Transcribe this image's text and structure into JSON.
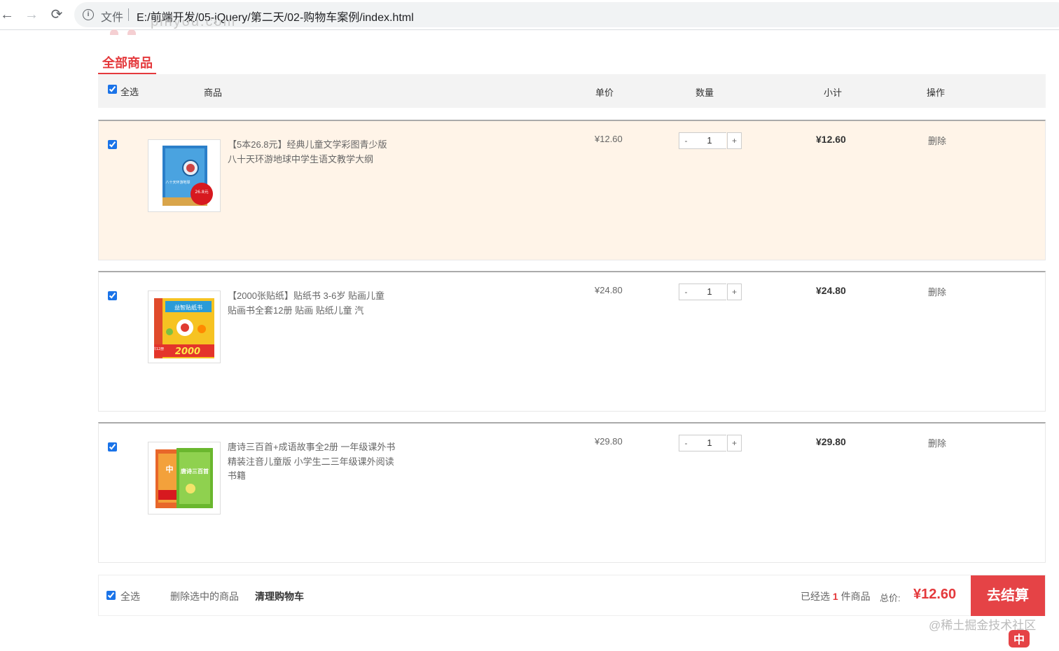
{
  "browser": {
    "back": "←",
    "forward": "→",
    "reload": "⟳",
    "info": "i",
    "file_label": "文件",
    "url": "E:/前端开发/05-jQuery/第二天/02-购物车案例/index.html"
  },
  "logo_text": "pinyou.com",
  "section_tab": "全部商品",
  "header": {
    "select_all": "全选",
    "goods": "商品",
    "unit_price": "单价",
    "quantity": "数量",
    "subtotal": "小计",
    "action": "操作"
  },
  "items": [
    {
      "name": "【5本26.8元】经典儿童文学彩图青少版八十天环游地球中学生语文教学大纲",
      "price": "¥12.60",
      "qty": "1",
      "subtotal": "¥12.60",
      "delete": "删除",
      "checked": true,
      "thumb_caption": "八十天环游地球",
      "thumb_badge": "26.8元"
    },
    {
      "name": "【2000张贴纸】贴纸书 3-6岁 贴画儿童 贴画书全套12册 贴画 贴纸儿童 汽",
      "price": "¥24.80",
      "qty": "1",
      "subtotal": "¥24.80",
      "delete": "删除",
      "checked": true,
      "thumb_title": "益智贴纸书",
      "thumb_count": "2000",
      "thumb_side": "共12册"
    },
    {
      "name": "唐诗三百首+成语故事全2册 一年级课外书 精装注音儿童版 小学生二三年级课外阅读书籍",
      "price": "¥29.80",
      "qty": "1",
      "subtotal": "¥29.80",
      "delete": "删除",
      "checked": true,
      "thumb_title": "唐诗三百首",
      "thumb_side": "中"
    }
  ],
  "qty_minus": "-",
  "qty_plus": "+",
  "toolbar": {
    "select_all": "全选",
    "delete_selected": "删除选中的商品",
    "clear_cart": "清理购物车",
    "selected_prefix": "已经选",
    "selected_count": "1",
    "selected_suffix": "件商品",
    "total_label": "总价:",
    "total_value": "¥12.60",
    "checkout": "去结算"
  },
  "watermark": "@稀土掘金技术社区",
  "ime_label": "中",
  "colors": {
    "accent": "#e4393c",
    "checkout_bg": "#e54346",
    "highlight_row": "#fff4e8",
    "header_bg": "#f3f3f3"
  }
}
